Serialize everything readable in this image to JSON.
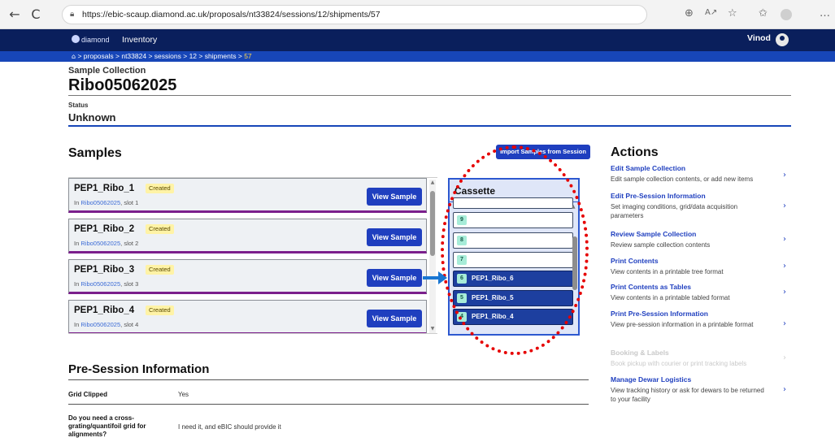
{
  "browser": {
    "back_icon": "←",
    "reload_icon": "C",
    "url": "https://ebic-scaup.diamond.ac.uk/proposals/nt33824/sessions/12/shipments/57",
    "toolbar_icons": [
      "zoom-icon",
      "read-aloud-icon",
      "favorite-icon",
      "collections-icon",
      "profile-icon",
      "more-icon"
    ]
  },
  "header": {
    "logo_text": "diamond",
    "nav_label": "Inventory",
    "user_name": "Vinod"
  },
  "breadcrumb": {
    "items": [
      "proposals",
      "nt33824",
      "sessions",
      "12",
      "shipments"
    ],
    "current": "57"
  },
  "collection": {
    "type_label": "Sample Collection",
    "name": "Ribo05062025",
    "status_label": "Status",
    "status_value": "Unknown"
  },
  "samples": {
    "heading": "Samples",
    "import_button": "Import Samples from Session",
    "view_label": "View Sample",
    "items": [
      {
        "name": "PEP1_Ribo_1",
        "badge": "Created",
        "prefix": "In",
        "container": "Ribo05062025",
        "slot": ", slot 1"
      },
      {
        "name": "PEP1_Ribo_2",
        "badge": "Created",
        "prefix": "In",
        "container": "Ribo05062025",
        "slot": ", slot 2"
      },
      {
        "name": "PEP1_Ribo_3",
        "badge": "Created",
        "prefix": "In",
        "container": "Ribo05062025",
        "slot": ", slot 3"
      },
      {
        "name": "PEP1_Ribo_4",
        "badge": "Created",
        "prefix": "In",
        "container": "Ribo05062025",
        "slot": ", slot 4"
      }
    ]
  },
  "cassette": {
    "title": "Cassette",
    "slots": [
      {
        "number": "9",
        "label": ""
      },
      {
        "number": "8",
        "label": ""
      },
      {
        "number": "7",
        "label": ""
      },
      {
        "number": "6",
        "label": "PEP1_Ribo_6"
      },
      {
        "number": "5",
        "label": "PEP1_Ribo_5"
      },
      {
        "number": "4",
        "label": "PEP1_Ribo_4"
      }
    ]
  },
  "presession": {
    "heading": "Pre-Session Information",
    "rows": [
      {
        "label": "Grid Clipped",
        "value": "Yes"
      },
      {
        "label": "Do you need a cross-grating/quantifoil grid for alignments?",
        "value": "I need it, and eBIC should provide it"
      }
    ]
  },
  "actions": {
    "heading": "Actions",
    "items": [
      {
        "title": "Edit Sample Collection",
        "desc": "Edit sample collection contents, or add new items",
        "enabled": true
      },
      {
        "title": "Edit Pre-Session Information",
        "desc": "Set imaging conditions, grid/data acquisition parameters",
        "enabled": true
      },
      {
        "title": "Review Sample Collection",
        "desc": "Review sample collection contents",
        "enabled": true
      },
      {
        "title": "Print Contents",
        "desc": "View contents in a printable tree format",
        "enabled": true
      },
      {
        "title": "Print Contents as Tables",
        "desc": "View contents in a printable tabled format",
        "enabled": true
      },
      {
        "title": "Print Pre-Session Information",
        "desc": "View pre-session information in a printable format",
        "enabled": true
      },
      {
        "title": "Booking & Labels",
        "desc": "Book pickup with courier or print tracking labels",
        "enabled": false
      },
      {
        "title": "Manage Dewar Logistics",
        "desc": "View tracking history or ask for dewars to be returned to your facility",
        "enabled": true
      }
    ]
  },
  "colors": {
    "header_bg": "#0a1f5c",
    "breadcrumb_bg": "#1746b8",
    "primary_button": "#1f3fbf",
    "sample_accent": "#7b1f8c",
    "badge_bg": "#fff3a6",
    "annotation_red": "#e60000",
    "annotation_arrow": "#1976d2"
  }
}
